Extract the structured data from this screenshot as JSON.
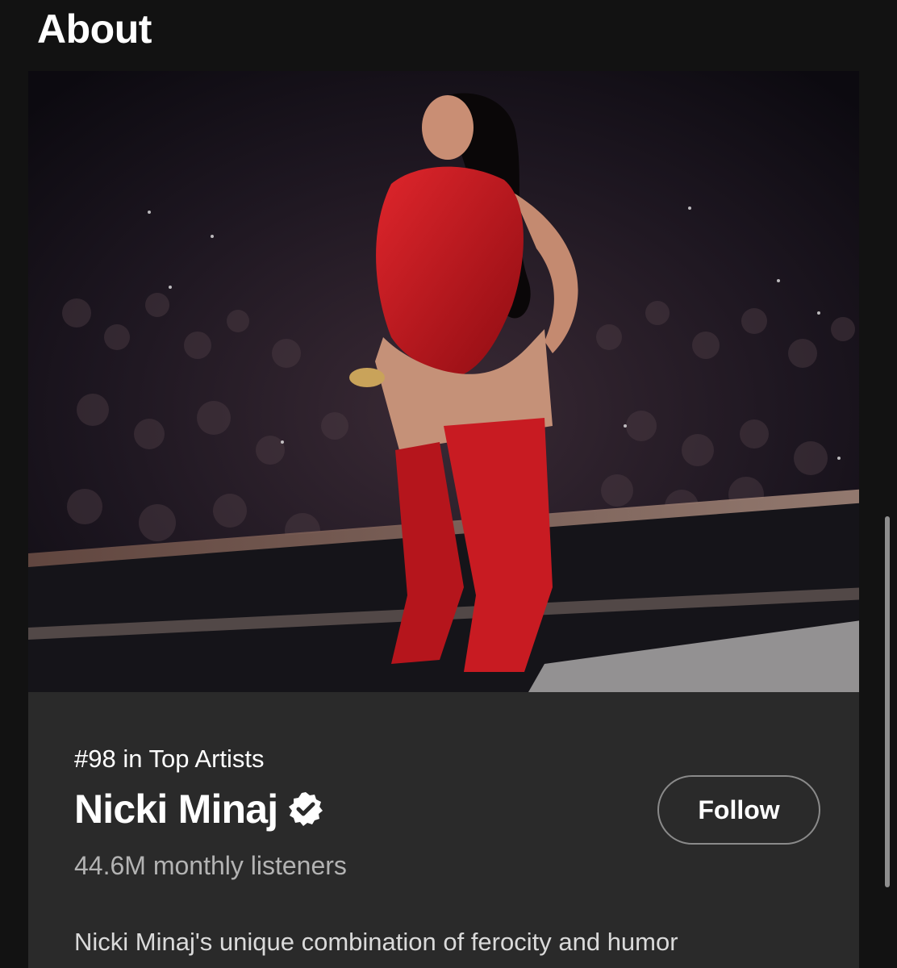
{
  "section": {
    "title": "About"
  },
  "artist": {
    "rank_text": "#98 in Top Artists",
    "name": "Nicki Minaj",
    "verified": true,
    "monthly_listeners": "44.6M monthly listeners",
    "bio": "Nicki Minaj's unique combination of ferocity and humor"
  },
  "actions": {
    "follow_label": "Follow"
  },
  "colors": {
    "background": "#121212",
    "card": "#2a2a2a",
    "verified_badge": "#ffffff",
    "secondary_text": "#b3b3b3"
  },
  "icons": {
    "verified": "verified-badge-icon"
  }
}
